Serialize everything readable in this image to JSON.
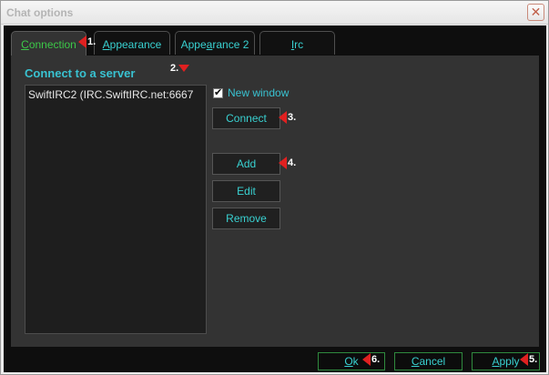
{
  "window": {
    "title": "Chat options",
    "close_glyph": "✕"
  },
  "tabs": [
    {
      "prefix": "",
      "hot": "C",
      "rest": "onnection",
      "active": true
    },
    {
      "prefix": "",
      "hot": "A",
      "rest": "ppearance",
      "active": false
    },
    {
      "prefix": "Appe",
      "hot": "a",
      "rest": "rance 2",
      "active": false
    },
    {
      "prefix": "",
      "hot": "I",
      "rest": "rc",
      "active": false
    }
  ],
  "connection": {
    "section_title": "Connect to a server",
    "servers": [
      "SwiftIRC2 (IRC.SwiftIRC.net:6667"
    ],
    "new_window": {
      "label": "New window",
      "checked": true
    },
    "buttons": {
      "connect": "Connect",
      "add": "Add",
      "edit": "Edit",
      "remove": "Remove"
    }
  },
  "footer": {
    "ok": {
      "hot": "O",
      "rest": "k"
    },
    "cancel": {
      "hot": "C",
      "rest": "ancel"
    },
    "apply": {
      "hot": "A",
      "rest": "pply"
    }
  },
  "markers": [
    "1.",
    "2.",
    "3.",
    "4.",
    "5.",
    "6."
  ],
  "colors": {
    "accent_cyan": "#39d1d1",
    "active_tab_green": "#3cc848",
    "marker_red": "#e02020",
    "footer_border_green": "#2f8a3e"
  }
}
